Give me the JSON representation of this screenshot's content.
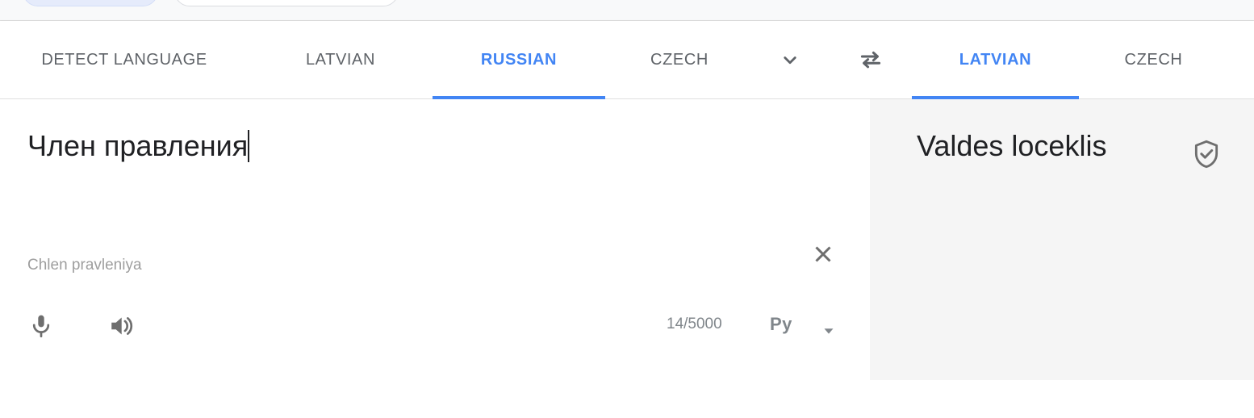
{
  "top_chips": {
    "selected_chip": "selected-chip",
    "plain_chip": "plain-chip"
  },
  "language_bar": {
    "source_tabs": [
      {
        "label": "DETECT LANGUAGE",
        "active": false
      },
      {
        "label": "LATVIAN",
        "active": false
      },
      {
        "label": "RUSSIAN",
        "active": true
      },
      {
        "label": "CZECH",
        "active": false
      }
    ],
    "more_icon": "chevron-down-icon",
    "swap_icon": "swap-horizontal-icon",
    "target_tabs": [
      {
        "label": "LATVIAN",
        "active": true
      },
      {
        "label": "CZECH",
        "active": false
      }
    ]
  },
  "source_panel": {
    "text": "Член правления",
    "transliteration": "Chlen pravleniya",
    "clear_icon": "close-icon",
    "mic_icon": "microphone-icon",
    "speaker_icon": "speaker-icon",
    "char_count": "14/5000",
    "keyboard_label": "Ру",
    "keyboard_caret_icon": "caret-down-icon"
  },
  "target_panel": {
    "text": "Valdes loceklis",
    "verified_icon": "verified-shield-icon",
    "speaker_icon": "speaker-icon"
  },
  "colors": {
    "accent": "#4285f4",
    "text_primary": "#202124",
    "text_secondary": "#5f6368",
    "text_muted": "#9e9e9e",
    "target_bg": "#f5f5f5",
    "chip_selected_bg": "#e5ebfb"
  }
}
